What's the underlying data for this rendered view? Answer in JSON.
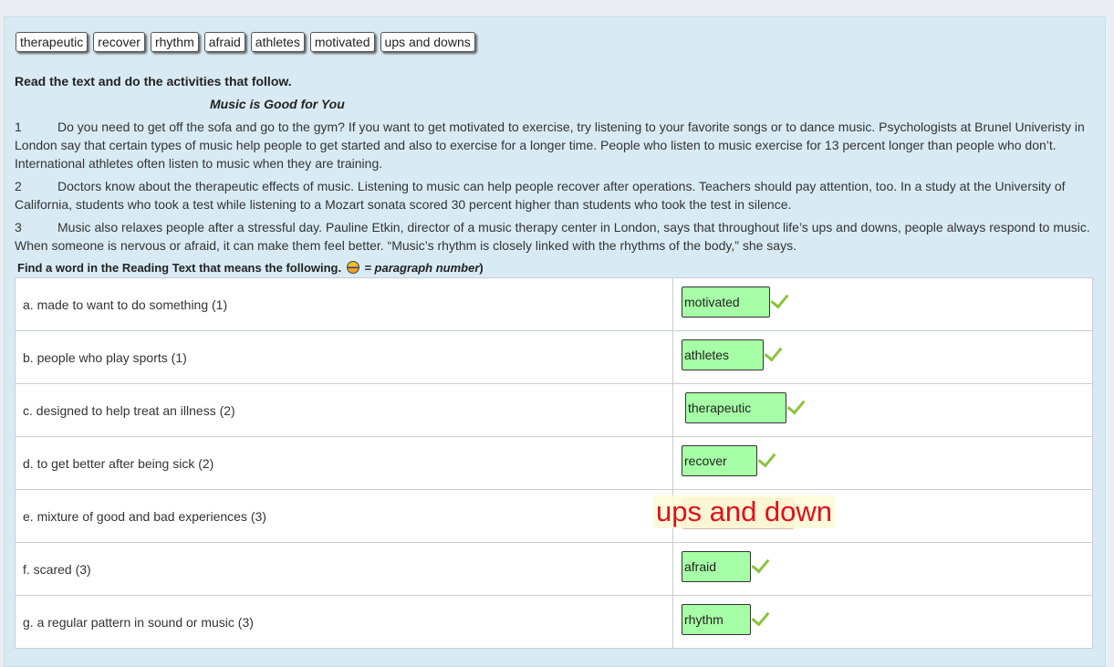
{
  "word_bank": [
    "therapeutic",
    "recover",
    "rhythm",
    "afraid",
    "athletes",
    "motivated",
    "ups and downs"
  ],
  "instructions": "Read the text and do the activities that follow.",
  "reading": {
    "title": "Music is Good for You",
    "paragraphs": [
      {
        "num": "1",
        "text": "Do you need to get off the sofa and go to the gym? If you want to get motivated to exercise, try listening to your favorite songs or to dance music. Psychologists at Brunel Univeristy in London say that certain types of music help people to get started and also to exercise for a longer time. People who listen to music exercise for 13 percent longer than people who don’t. International athletes often listen to music when they are training."
      },
      {
        "num": "2",
        "text": "Doctors know about the therapeutic effects of music. Listening to music can help people recover after operations. Teachers should pay attention, too. In a study at the University of California, students who took a test while listening to a Mozart sonata scored 30 percent higher than students who took the test in silence."
      },
      {
        "num": "3",
        "text": "Music also relaxes people after a stressful day. Pauline Etkin, director of a music therapy center in London, says that throughout life’s ups and downs, people always respond to music. When someone is nervous or afraid, it can make them feel better. “Music’s rhythm is closely linked with the rhythms of the body,” she says."
      }
    ]
  },
  "find_instruction": {
    "lead": "Find a word in the Reading Text that means the following.",
    "legend": " = paragraph number",
    "close": ")"
  },
  "questions": [
    {
      "prompt": "a.  made to want to do something (1)",
      "answer": "motivated",
      "status": "correct"
    },
    {
      "prompt": "b.  people who play sports (1)",
      "answer": "athletes",
      "status": "correct"
    },
    {
      "prompt": "c.  designed to help treat an illness (2)",
      "answer": "therapeutic",
      "status": "correct"
    },
    {
      "prompt": "d.  to get better after being sick (2)",
      "answer": "recover",
      "status": "correct"
    },
    {
      "prompt": "e.  mixture of good and bad experiences (3)",
      "answer": "ups and down",
      "status": "incorrect"
    },
    {
      "prompt": "f.  scared (3)",
      "answer": "afraid",
      "status": "correct"
    },
    {
      "prompt": "g.  a regular pattern in sound or music (3)",
      "answer": "rhythm",
      "status": "correct"
    }
  ],
  "colors": {
    "correct_fill": "#a6ffa6",
    "check": "#8ac43a",
    "incorrect_text": "#e0101a",
    "panel": "#d8ebf5"
  }
}
